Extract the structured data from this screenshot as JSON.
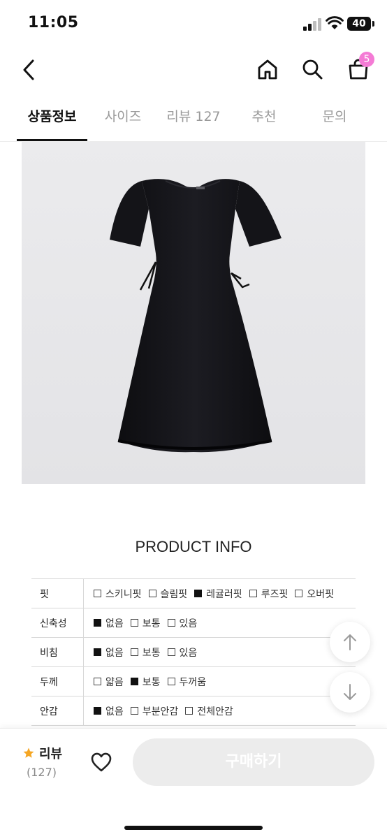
{
  "status_bar": {
    "time": "11:05",
    "battery": "40"
  },
  "header": {
    "cart_count": "5"
  },
  "tabs": [
    {
      "label": "상품정보",
      "active": true
    },
    {
      "label": "사이즈",
      "active": false
    },
    {
      "label": "리뷰 127",
      "active": false
    },
    {
      "label": "추천",
      "active": false
    },
    {
      "label": "문의",
      "active": false
    }
  ],
  "product_info": {
    "title": "PRODUCT INFO",
    "rows": [
      {
        "label": "핏",
        "options": [
          {
            "text": "스키니핏",
            "checked": false
          },
          {
            "text": "슬림핏",
            "checked": false
          },
          {
            "text": "레귤러핏",
            "checked": true
          },
          {
            "text": "루즈핏",
            "checked": false
          },
          {
            "text": "오버핏",
            "checked": false
          }
        ]
      },
      {
        "label": "신축성",
        "options": [
          {
            "text": "없음",
            "checked": true
          },
          {
            "text": "보통",
            "checked": false
          },
          {
            "text": "있음",
            "checked": false
          }
        ]
      },
      {
        "label": "비침",
        "options": [
          {
            "text": "없음",
            "checked": true
          },
          {
            "text": "보통",
            "checked": false
          },
          {
            "text": "있음",
            "checked": false
          }
        ]
      },
      {
        "label": "두께",
        "options": [
          {
            "text": "얇음",
            "checked": false
          },
          {
            "text": "보통",
            "checked": true
          },
          {
            "text": "두꺼움",
            "checked": false
          }
        ]
      },
      {
        "label": "안감",
        "options": [
          {
            "text": "없음",
            "checked": true
          },
          {
            "text": "부분안감",
            "checked": false
          },
          {
            "text": "전체안감",
            "checked": false
          }
        ]
      }
    ]
  },
  "bottom_bar": {
    "review_label": "리뷰",
    "review_count": "(127)",
    "buy_label": "구매하기"
  },
  "colors": {
    "badge": "#f47bd5",
    "star": "#f5a623",
    "tab_active": "#111111",
    "tab_inactive": "#9a9a9a",
    "buy_button_bg": "#ececec"
  }
}
